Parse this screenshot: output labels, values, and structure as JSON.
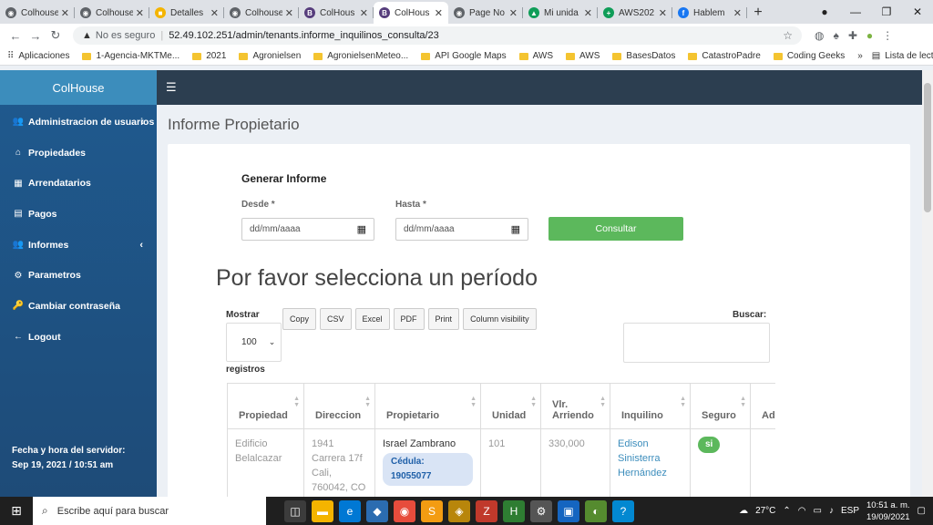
{
  "browser": {
    "tabs": [
      {
        "label": "Colhouse",
        "color": "#5f6368",
        "glyph": "◉"
      },
      {
        "label": "Colhouse",
        "color": "#5f6368",
        "glyph": "◉"
      },
      {
        "label": "Detalles",
        "color": "#f4b400",
        "glyph": "■"
      },
      {
        "label": "Colhouse",
        "color": "#5f6368",
        "glyph": "◉"
      },
      {
        "label": "ColHous",
        "color": "#563d7c",
        "glyph": "B"
      },
      {
        "label": "ColHous",
        "color": "#563d7c",
        "glyph": "B",
        "active": true
      },
      {
        "label": "Page No",
        "color": "#5f6368",
        "glyph": "◉"
      },
      {
        "label": "Mi unida",
        "color": "#0f9d58",
        "glyph": "▲"
      },
      {
        "label": "AWS202",
        "color": "#0f9d58",
        "glyph": "+"
      },
      {
        "label": "Hablem",
        "color": "#1877f2",
        "glyph": "f"
      }
    ],
    "security_warning": "No es seguro",
    "url": "52.49.102.251/admin/tenants.informe_inquilinos_consulta/23",
    "bookmarks": [
      "Aplicaciones",
      "1-Agencia-MKTMe...",
      "2021",
      "Agronielsen",
      "AgronielsenMeteo...",
      "API Google Maps",
      "AWS",
      "AWS",
      "BasesDatos",
      "CatastroPadre",
      "Coding Geeks"
    ],
    "more": "»",
    "reading_list": "Lista de lectura"
  },
  "sidebar": {
    "brand": "ColHouse",
    "items": [
      {
        "label": "Administracion de usuarios",
        "icon": "users-icon",
        "glyph": "👥",
        "caret": "‹"
      },
      {
        "label": "Propiedades",
        "icon": "home-icon",
        "glyph": "⌂",
        "caret": ""
      },
      {
        "label": "Arrendatarios",
        "icon": "building-icon",
        "glyph": "▦",
        "caret": ""
      },
      {
        "label": "Pagos",
        "icon": "money-icon",
        "glyph": "▤",
        "caret": ""
      },
      {
        "label": "Informes",
        "icon": "users-icon",
        "glyph": "👥",
        "caret": "‹"
      },
      {
        "label": "Parametros",
        "icon": "cogs-icon",
        "glyph": "⚙",
        "caret": ""
      },
      {
        "label": "Cambiar contraseña",
        "icon": "key-icon",
        "glyph": "🔑",
        "caret": ""
      },
      {
        "label": "Logout",
        "icon": "sign-out-icon",
        "glyph": "←",
        "caret": ""
      }
    ],
    "server_time_label": "Fecha y hora del servidor:",
    "server_time_value": "Sep 19, 2021 / 10:51 am"
  },
  "main": {
    "page_title": "Informe Propietario",
    "form_title": "Generar Informe",
    "desde_label": "Desde *",
    "hasta_label": "Hasta *",
    "date_placeholder": "dd/mm/aaaa",
    "consultar": "Consultar",
    "prompt": "Por favor selecciona un período",
    "mostrar": "Mostrar",
    "length_value": "100",
    "registros": "registros",
    "buttons": [
      "Copy",
      "CSV",
      "Excel",
      "PDF",
      "Print",
      "Column visibility"
    ],
    "buscar": "Buscar:"
  },
  "table": {
    "headers": [
      "Propiedad",
      "Direccion",
      "Propietario",
      "Unidad",
      "Vlr. Arriendo",
      "Inquilino",
      "Seguro",
      "Ad"
    ],
    "rows": [
      {
        "propiedad": "Edificio Belalcazar",
        "direccion": "1941 Carrera 17f Cali, 760042, CO",
        "propietario": "Israel Zambrano",
        "cedula": "Cédula: 19055077",
        "unidad": "101",
        "arriendo": "330,000",
        "inquilino": "Edison Sinisterra Hernández",
        "seguro": "si"
      }
    ]
  },
  "taskbar": {
    "search_placeholder": "Escribe aquí para buscar",
    "weather": "27°C",
    "language": "ESP",
    "time": "10:51 a. m.",
    "date": "19/09/2021"
  }
}
